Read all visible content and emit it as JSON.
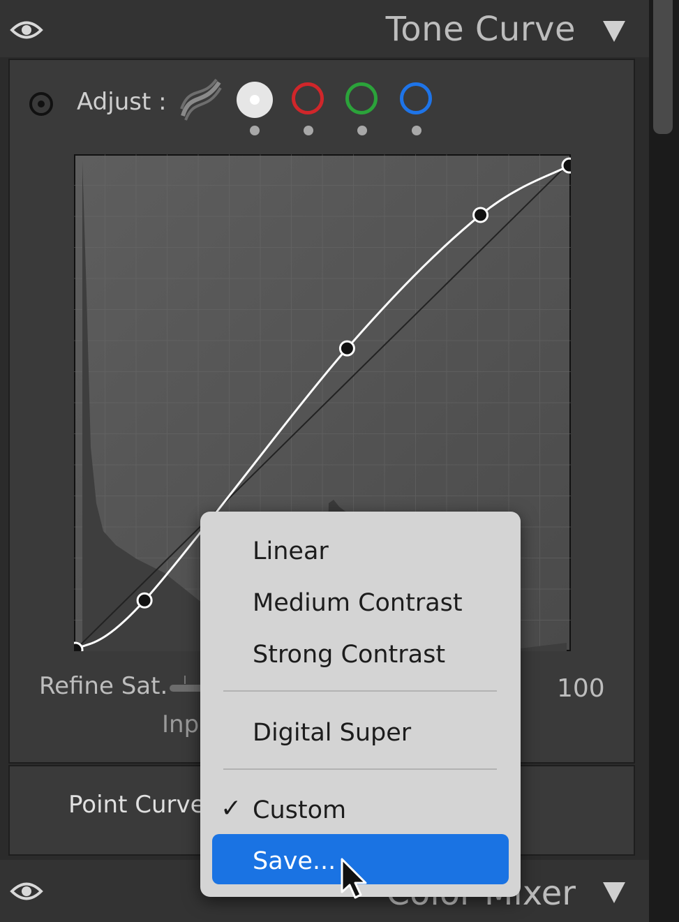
{
  "tone_curve_panel": {
    "title": "Tone Curve",
    "adjust_label": "Adjust :",
    "channels": [
      "parametric",
      "rgb",
      "red",
      "green",
      "blue"
    ],
    "selected_channel": "rgb",
    "channel_colors": {
      "red": "#d0262a",
      "green": "#2ba33a",
      "blue": "#1e74e8"
    },
    "curve_points": [
      {
        "input": 0,
        "output": 0
      },
      {
        "input": 14,
        "output": 10
      },
      {
        "input": 55,
        "output": 61
      },
      {
        "input": 82,
        "output": 88
      },
      {
        "input": 100,
        "output": 98
      }
    ],
    "refine_saturation_label": "Refine Sat.",
    "input_label": "Inpu",
    "value_label": "100",
    "point_curve_label": "Point Curve :"
  },
  "next_panel": {
    "title": "Color Mixer"
  },
  "point_curve_menu": {
    "items": [
      "Linear",
      "Medium Contrast",
      "Strong Contrast",
      "Digital Super",
      "Custom",
      "Save..."
    ],
    "checked": "Custom",
    "highlighted": "Save...",
    "check_mark": "✓",
    "highlight_color": "#1a73e3"
  }
}
